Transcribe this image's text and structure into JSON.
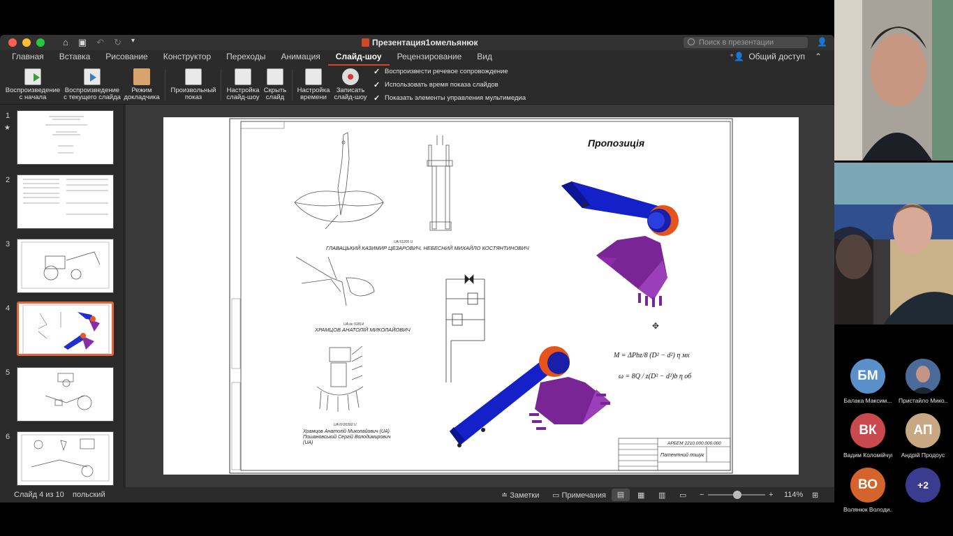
{
  "window": {
    "title": "Презентация1омельянюк",
    "search_placeholder": "Поиск в презентации",
    "share_label": "Общий доступ"
  },
  "tabs": [
    {
      "label": "Главная"
    },
    {
      "label": "Вставка"
    },
    {
      "label": "Рисование"
    },
    {
      "label": "Конструктор"
    },
    {
      "label": "Переходы"
    },
    {
      "label": "Анимация"
    },
    {
      "label": "Слайд-шоу",
      "active": true
    },
    {
      "label": "Рецензирование"
    },
    {
      "label": "Вид"
    }
  ],
  "ribbon": {
    "play_from_start": [
      "Воспроизведение",
      "с начала"
    ],
    "play_from_current": [
      "Воспроизведение",
      "с текущего слайда"
    ],
    "presenter_mode": [
      "Режим",
      "докладчика"
    ],
    "custom_show": [
      "Произвольный",
      "показ"
    ],
    "setup_show": [
      "Настройка",
      "слайд-шоу"
    ],
    "hide_slide": [
      "Скрыть",
      "слайд"
    ],
    "rehearse_timings": [
      "Настройка",
      "времени"
    ],
    "record_show": [
      "Записать",
      "слайд-шоу"
    ],
    "checks": [
      "Воспроизвести речевое сопровождение",
      "Использовать время показа слайдов",
      "Показать элементы управления мультимедиа"
    ]
  },
  "thumbnails": [
    "1",
    "2",
    "3",
    "4",
    "5",
    "6"
  ],
  "selected_slide": 4,
  "slide": {
    "title": "Пропозиція",
    "stamp_top": "АРБЕМ 2210.000.000.000",
    "caption1_code": "UA 51205 U",
    "caption1": "ГЛАВАЦЬКИЙ КАЗИМИР ЦЕЗАРОВИЧ, НЕБЕСНИЙ МИХАЙЛО КОСТЯНТИНОВИЧ",
    "caption2_code": "UA № 51814",
    "caption2": "ХРАМЦОВ АНАТОЛІЙ МИКОЛАЙОВИЧ",
    "caption3_code": "UA Nº26392 U",
    "caption3": [
      "Храмцов Анатолій Миколайович (UA)",
      "Пошановський Сергій Володимирович",
      "(UA)"
    ],
    "formula1": "M = ΔPbz/8 (D² − d²) η мх",
    "formula2": "ω = 8Q / z(D² − d²)b η об",
    "stamp_code": "АРБЕМ 2210.000.000.000",
    "stamp_name": "Патентний пошук"
  },
  "status": {
    "slide_of": "Слайд 4 из 10",
    "language": "польский",
    "notes": "Заметки",
    "comments": "Примечания",
    "zoom": "114%"
  },
  "participants": [
    {
      "initials": "БМ",
      "name": "Балака Максим...",
      "color": "#5b8fc9"
    },
    {
      "initials": "",
      "name": "Пристайло Мико...",
      "color": "#3a5a8a"
    },
    {
      "initials": "ВК",
      "name": "Вадим Коломійчук",
      "color": "#c9494f"
    },
    {
      "initials": "АП",
      "name": "Андрій Продоус",
      "color": "#c8a882"
    },
    {
      "initials": "ВО",
      "name": "Волянюк Володи...",
      "color": "#d5632c"
    },
    {
      "initials": "+2",
      "name": "",
      "color": "#3a3d8f"
    }
  ]
}
